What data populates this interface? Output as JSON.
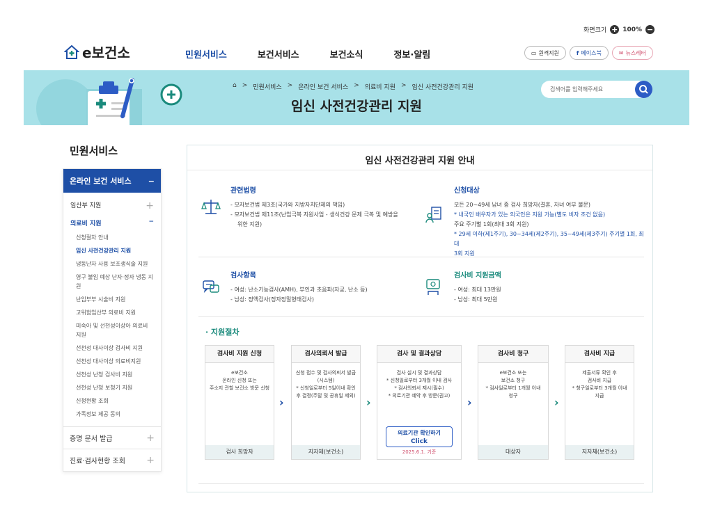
{
  "topbar": {
    "zoom_label": "화면크기",
    "zoom_value": "100%",
    "plus": "+",
    "minus": "−"
  },
  "logo": {
    "text": "e보건소"
  },
  "gnb": [
    "민원서비스",
    "보건서비스",
    "보건소식",
    "정보·알림"
  ],
  "sns": {
    "remote": "원격지원",
    "facebook": "페이스북",
    "news": "뉴스레터"
  },
  "breadcrumb": [
    "민원서비스",
    "온라인 보건 서비스",
    "의료비 지원",
    "임신 사전건강관리 지원"
  ],
  "page_title": "임신 사전건강관리 지원",
  "search": {
    "placeholder": "검색어를 입력해주세요"
  },
  "side": {
    "title": "민원서비스",
    "head": "온라인 보건 서비스",
    "head_toggle": "−",
    "items": [
      {
        "label": "임산부 지원",
        "toggle": "+"
      },
      {
        "label": "의료비 지원",
        "toggle": "−"
      }
    ],
    "subs": [
      "신청절차 안내",
      "임신 사전건강관리 지원",
      "냉동난자 사용 보조생식술 지원",
      "영구 불임 예상 난자·정자 냉동 지원",
      "난임부부 시술비 지원",
      "고위험임산부 의료비 지원",
      "미숙아 및 선천성이상아 의료비 지원",
      "선천성 대사이상 검사비 지원",
      "선천성 대사이상 의료비지원",
      "선천성 난청 검사비 지원",
      "선천성 난청 보청기 지원",
      "신청현황 조회",
      "가족정보 제공 동의"
    ],
    "foot": [
      {
        "label": "증명 문서 발급",
        "toggle": "+"
      },
      {
        "label": "진료·검사현황 조회",
        "toggle": "+"
      }
    ]
  },
  "main": {
    "title": "임신 사전건강관리 지원 안내",
    "law": {
      "title": "관련법령",
      "lines": [
        "모자보건법 제3조(국가와 지방자치단체의 책임)",
        "모자보건법 제11조(난임극복 지원사업 - 생식건강 문제 극복 및 예방을",
        "위한 지원)"
      ]
    },
    "target": {
      "title": "신청대상",
      "lines": [
        "모든 20~49세 남녀 중 검사 희망자(결혼, 자녀 여부 불문)",
        "* 내국인 배우자가 있는 외국인은 지원 가능(별도 비자 조건 없음)",
        "주요 주기별 1회(최대 3회 지원)",
        "* 29세 이하(제1주기), 30~34세(제2주기), 35~49세(제3주기) 주기별 1회, 최대",
        "3회 지원"
      ]
    },
    "items": {
      "title": "검사항목",
      "lines": [
        "여성: 난소기능검사(AMH), 부인과 초음파(자궁, 난소 등)",
        "남성: 정액검사(정자정밀형태검사)"
      ]
    },
    "amount": {
      "title": "검사비 지원금액",
      "lines": [
        "여성: 최대 13만원",
        "남성: 최대 5만원"
      ]
    },
    "process_title": "· 지원절차",
    "steps": [
      {
        "title": "검사비 지원 신청",
        "body": [
          "e보건소",
          "온라인 신청 또는",
          "주소지 관할 보건소 방문 신청"
        ],
        "foot": "검사 희망자"
      },
      {
        "title": "검사의뢰서 발급",
        "body": [
          "신청 접수 및 검사의뢰서 발급",
          "(시스템)",
          "* 신청일로부터 5일이내 확인",
          "후 결정(주말 및 공휴일 제외)"
        ],
        "foot": "지자체(보건소)"
      },
      {
        "title": "검사 및 결과상담",
        "body": [
          "검사 실시 및 결과상담",
          "* 신청일로부터 3개월 이내 검사",
          "* 검사의뢰서 제시(필수)",
          "* 의료기관 예약 후 방문(권고)"
        ],
        "button": [
          "의료기관 확인하기",
          "Click"
        ],
        "date": "2025.6.1. 기준"
      },
      {
        "title": "검사비 청구",
        "body": [
          "e보건소 또는",
          "보건소 청구",
          "* 검사일로부터 1개월 이내",
          "청구"
        ],
        "foot": "대상자"
      },
      {
        "title": "검사비 지급",
        "body": [
          "제출서류 확인 후",
          "검사비 지급",
          "* 청구일로부터 3개월 이내",
          "지급"
        ],
        "foot": "지자체(보건소)"
      }
    ]
  }
}
